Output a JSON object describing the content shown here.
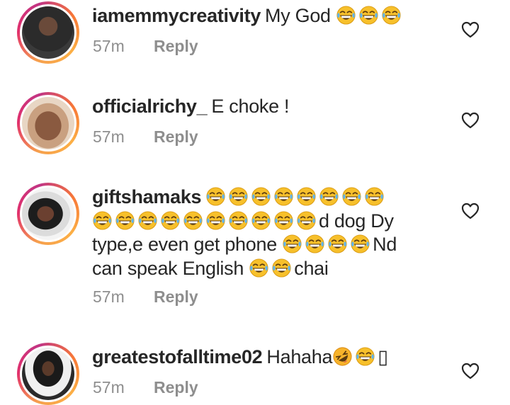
{
  "comments": [
    {
      "username": "iamemmycreativity",
      "text_parts": [
        "My God",
        "😂😂😂"
      ],
      "time": "57m",
      "reply": "Reply",
      "avatar_icon": "profile-photo-icon"
    },
    {
      "username": "officialrichy_",
      "text_parts": [
        "E choke !"
      ],
      "time": "57m",
      "reply": "Reply",
      "avatar_icon": "profile-photo-icon"
    },
    {
      "username": "giftshamaks",
      "text_parts": [
        "😂😂😂😂😂😂😂😂😂😂😂😂😂😂😂😂😂😂",
        "d dog Dy type,e even get phone",
        "😂😂😂😂",
        "Nd can speak English",
        "😂😂",
        "chai"
      ],
      "time": "57m",
      "reply": "Reply",
      "avatar_icon": "profile-photo-icon"
    },
    {
      "username": "greatestofalltime02",
      "text_parts": [
        "Hahaha",
        "🤣😂",
        "▯"
      ],
      "time": "57m",
      "reply": "Reply",
      "avatar_icon": "profile-photo-icon"
    }
  ],
  "colors": {
    "text": "#262626",
    "meta": "#8e8e8e",
    "ring_start": "#f6a04d",
    "ring_end": "#c13584",
    "emoji_yellow": "#f7c02b"
  },
  "icons": [
    "heart-outline-icon",
    "face-with-tears-of-joy-icon",
    "rolling-on-floor-laughing-icon"
  ]
}
